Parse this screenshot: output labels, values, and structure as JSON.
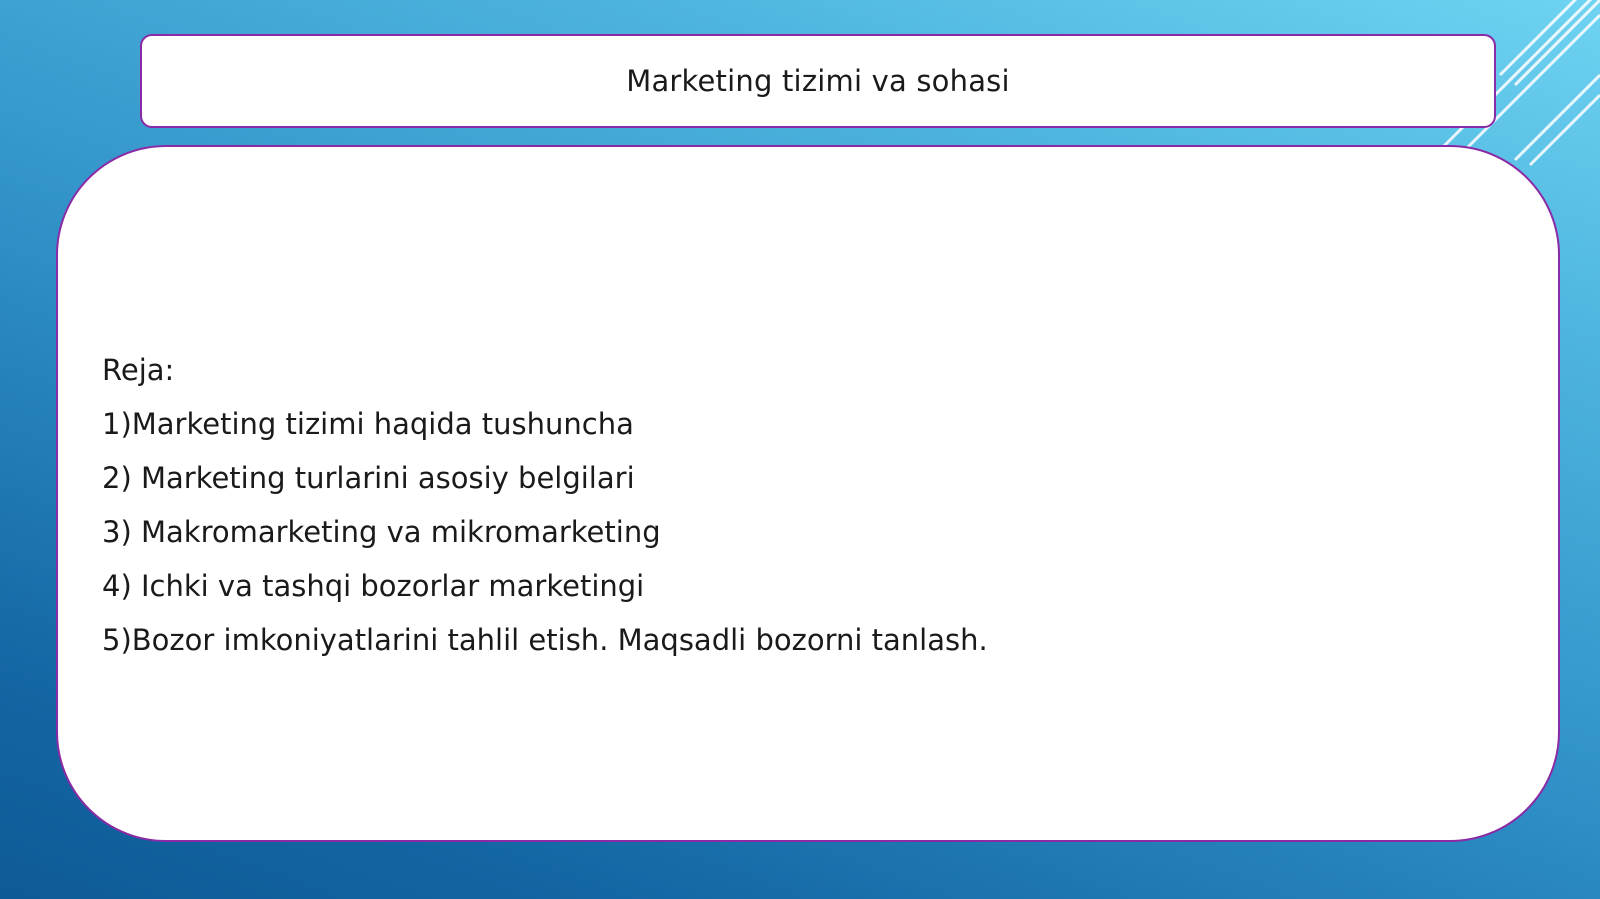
{
  "slide": {
    "title": "Marketing tizimi va sohasi",
    "plan_heading": "Reja:",
    "plan_items": [
      "1)Marketing tizimi haqida tushuncha",
      "2) Marketing turlarini asosiy belgilari",
      "3) Makromarketing va mikromarketing",
      "4) Ichki va tashqi bozorlar marketingi",
      "5)Bozor imkoniyatlarini tahlil etish. Maqsadli bozorni tanlash."
    ]
  },
  "colors": {
    "border_accent": "#8a2aa6",
    "background_top": "#6fd3f2",
    "background_bottom": "#0e5a96"
  }
}
